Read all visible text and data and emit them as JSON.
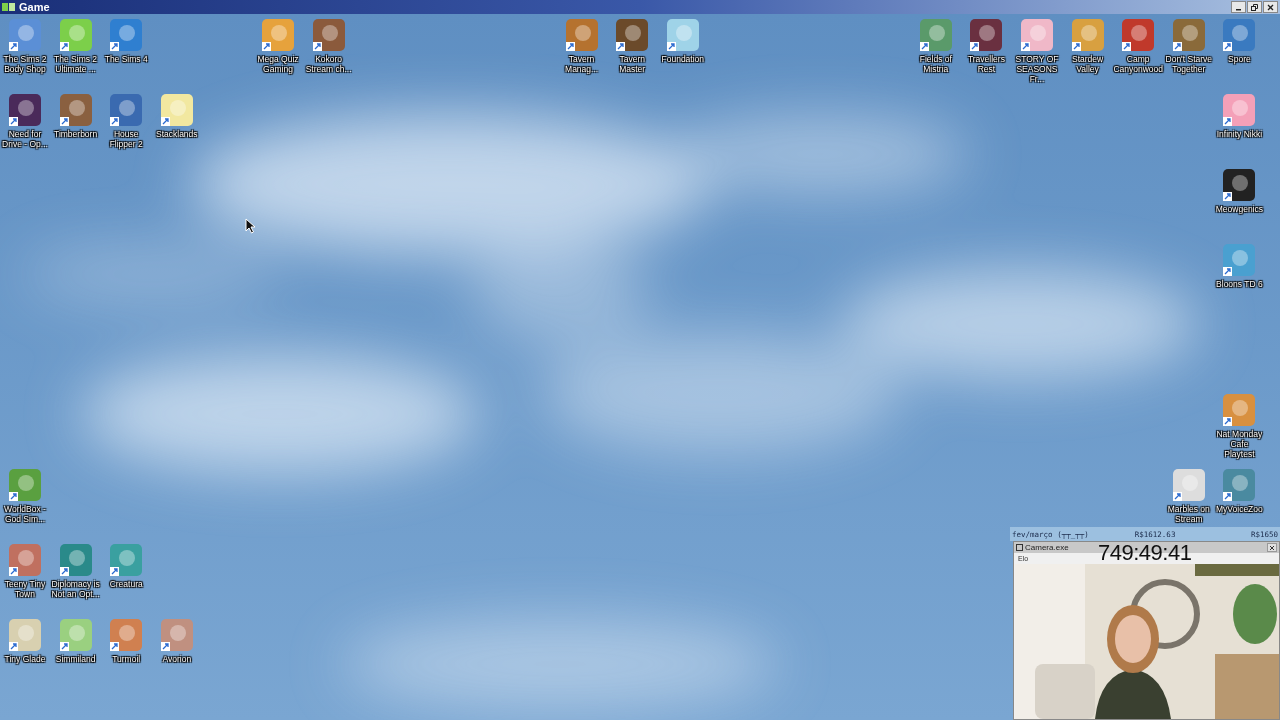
{
  "window": {
    "title": "Game"
  },
  "desktop_icons": [
    {
      "label": "The Sims 2 Body Shop"
    },
    {
      "label": "The Sims 2 Ultimate ..."
    },
    {
      "label": "The Sims 4"
    },
    {
      "label": "Mega Quiz Gaming"
    },
    {
      "label": "Kokoro Stream ch..."
    },
    {
      "label": "Tavern Manag..."
    },
    {
      "label": "Tavern Master"
    },
    {
      "label": "Foundation"
    },
    {
      "label": "Fields of Mistria"
    },
    {
      "label": "Travellers Rest"
    },
    {
      "label": "STORY OF SEASONS Fr..."
    },
    {
      "label": "Stardew Valley"
    },
    {
      "label": "Camp Canyonwood"
    },
    {
      "label": "Don't Starve Together"
    },
    {
      "label": "Spore"
    },
    {
      "label": "Need for Drive - Op..."
    },
    {
      "label": "Timberborn"
    },
    {
      "label": "House Flipper 2"
    },
    {
      "label": "Stacklands"
    },
    {
      "label": "Infinity Nikki"
    },
    {
      "label": "Meowgenics"
    },
    {
      "label": "Bloons TD 6"
    },
    {
      "label": "Nat Monday Cafe Playtest"
    },
    {
      "label": "WorldBox - God Sim..."
    },
    {
      "label": "Marbles on Stream"
    },
    {
      "label": "MyVoiceZoo"
    },
    {
      "label": "Teeny Tiny Town"
    },
    {
      "label": "Diplomacy is Not an Opt..."
    },
    {
      "label": "Creatura"
    },
    {
      "label": "Tiny Glade"
    },
    {
      "label": "Simmiland"
    },
    {
      "label": "Turmoil"
    },
    {
      "label": "Avorion"
    }
  ],
  "budget_bar": {
    "period": "fev/março (┬┬_┬┬)",
    "current": "R$1612.63",
    "goal": "R$1650"
  },
  "camera_window": {
    "title": "Camera.exe",
    "menu": "Elo",
    "timer": "749:49:41"
  }
}
